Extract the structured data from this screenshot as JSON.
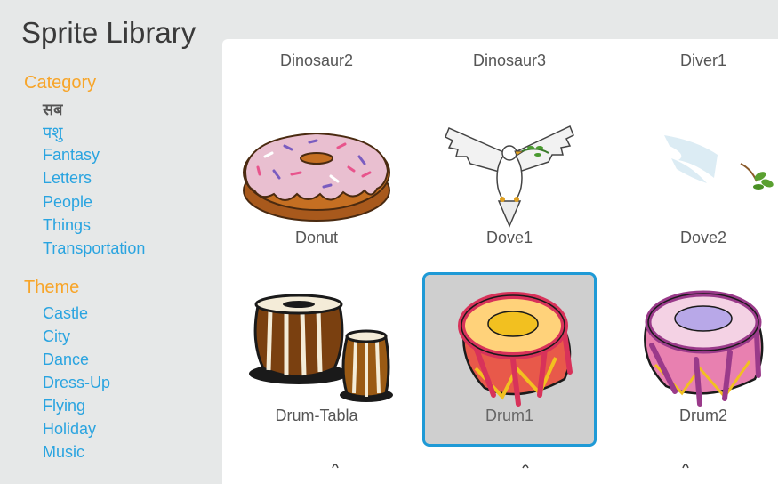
{
  "header": {
    "title": "Sprite Library"
  },
  "sidebar": {
    "category_heading": "Category",
    "categories": [
      {
        "label": "सब",
        "active": true
      },
      {
        "label": "पशु",
        "active": false
      },
      {
        "label": "Fantasy",
        "active": false
      },
      {
        "label": "Letters",
        "active": false
      },
      {
        "label": "People",
        "active": false
      },
      {
        "label": "Things",
        "active": false
      },
      {
        "label": "Transportation",
        "active": false
      }
    ],
    "theme_heading": "Theme",
    "themes": [
      {
        "label": "Castle"
      },
      {
        "label": "City"
      },
      {
        "label": "Dance"
      },
      {
        "label": "Dress-Up"
      },
      {
        "label": "Flying"
      },
      {
        "label": "Holiday"
      },
      {
        "label": "Music"
      }
    ]
  },
  "library": {
    "top_row": [
      "Dinosaur2",
      "Dinosaur3",
      "Diver1"
    ],
    "sprites": [
      {
        "name": "Donut",
        "icon": "donut-icon",
        "selected": false
      },
      {
        "name": "Dove1",
        "icon": "dove-icon",
        "selected": false
      },
      {
        "name": "Dove2",
        "icon": "dove-partial-icon",
        "selected": false
      },
      {
        "name": "Drum-Tabla",
        "icon": "tabla-drum-icon",
        "selected": false
      },
      {
        "name": "Drum1",
        "icon": "drum-icon",
        "selected": true
      },
      {
        "name": "Drum2",
        "icon": "drum-pink-icon",
        "selected": false
      }
    ]
  },
  "colors": {
    "accent_orange": "#f7a52a",
    "link_blue": "#2aa4e0",
    "selection_blue": "#1f9ad6",
    "selected_tile_bg": "#cfcfcf"
  }
}
